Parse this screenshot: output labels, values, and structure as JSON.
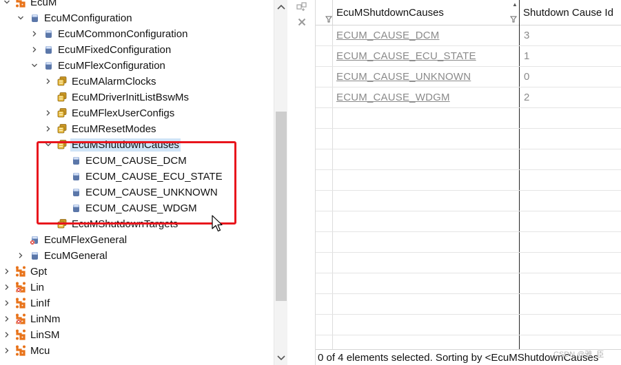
{
  "tree": {
    "items": [
      {
        "label": "EcuM",
        "icon": "module-icon",
        "expanded": true,
        "twisty": "expanded"
      },
      {
        "label": "EcuMConfiguration",
        "icon": "container-icon",
        "twisty": "expanded"
      },
      {
        "label": "EcuMCommonConfiguration",
        "icon": "container-icon",
        "twisty": "collapsed"
      },
      {
        "label": "EcuMFixedConfiguration",
        "icon": "container-icon",
        "twisty": "collapsed"
      },
      {
        "label": "EcuMFlexConfiguration",
        "icon": "container-icon",
        "twisty": "expanded"
      },
      {
        "label": "EcuMAlarmClocks",
        "icon": "list-container-icon",
        "twisty": "collapsed"
      },
      {
        "label": "EcuMDriverInitListBswMs",
        "icon": "list-container-icon",
        "twisty": "none"
      },
      {
        "label": "EcuMFlexUserConfigs",
        "icon": "list-container-icon",
        "twisty": "collapsed"
      },
      {
        "label": "EcuMResetModes",
        "icon": "list-container-icon",
        "twisty": "collapsed"
      },
      {
        "label": "EcuMShutdownCauses",
        "icon": "list-container-icon",
        "twisty": "expanded",
        "selected": true
      },
      {
        "label": "ECUM_CAUSE_DCM",
        "icon": "container-icon",
        "twisty": "none"
      },
      {
        "label": "ECUM_CAUSE_ECU_STATE",
        "icon": "container-icon",
        "twisty": "none"
      },
      {
        "label": "ECUM_CAUSE_UNKNOWN",
        "icon": "container-icon",
        "twisty": "none"
      },
      {
        "label": "ECUM_CAUSE_WDGM",
        "icon": "container-icon",
        "twisty": "none"
      },
      {
        "label": "EcuMShutdownTargets",
        "icon": "list-container-icon",
        "twisty": "none"
      },
      {
        "label": "EcuMFlexGeneral",
        "icon": "container-error-icon",
        "twisty": "none"
      },
      {
        "label": "EcuMGeneral",
        "icon": "container-icon",
        "twisty": "collapsed"
      },
      {
        "label": "Gpt",
        "icon": "module-icon",
        "twisty": "collapsed"
      },
      {
        "label": "Lin",
        "icon": "module-error-icon",
        "twisty": "collapsed"
      },
      {
        "label": "LinIf",
        "icon": "module-icon",
        "twisty": "collapsed"
      },
      {
        "label": "LinNm",
        "icon": "module-error-icon",
        "twisty": "collapsed"
      },
      {
        "label": "LinSM",
        "icon": "module-icon",
        "twisty": "collapsed"
      },
      {
        "label": "Mcu",
        "icon": "module-icon",
        "twisty": "collapsed"
      }
    ]
  },
  "table": {
    "headers": [
      "EcuMShutdownCauses",
      "Shutdown Cause Id"
    ],
    "rows": [
      {
        "name": "ECUM_CAUSE_DCM",
        "id": "3"
      },
      {
        "name": "ECUM_CAUSE_ECU_STATE",
        "id": "1"
      },
      {
        "name": "ECUM_CAUSE_UNKNOWN",
        "id": "0"
      },
      {
        "name": "ECUM_CAUSE_WDGM",
        "id": "2"
      }
    ],
    "status": "0 of 4 elements selected. Sorting by <EcuMShutdownCauses"
  },
  "toolbar": {
    "icons": [
      "add-element-icon",
      "delete-element-icon"
    ]
  },
  "watermark": "CSDN @雅_臣",
  "colors": {
    "highlight_box": "#e8141c",
    "selection": "#cfe4f7",
    "module_orange": "#e8731a"
  }
}
